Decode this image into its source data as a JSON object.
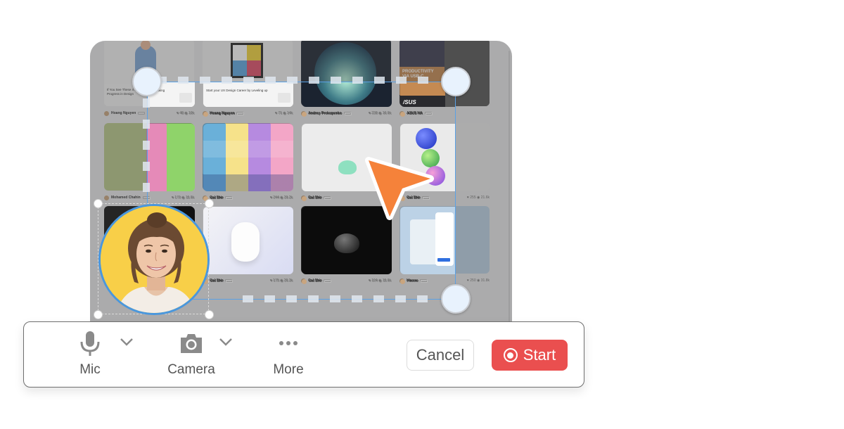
{
  "gallery": {
    "cards": [
      {
        "author": "Hoang Nguyen",
        "caption": "If You See These 4 Signs, You're Making Progress in Design",
        "likes": "48",
        "views": "10k",
        "thumb": "illustration-person"
      },
      {
        "author": "Hoang Nguyen",
        "caption": "Start your UX Design Career by Leveling up",
        "likes": "71",
        "views": "14k",
        "thumb": "illustration-ux"
      },
      {
        "author": "Andrey Prokopenko",
        "caption": "",
        "likes": "238",
        "views": "16.6k",
        "thumb": "forest-circle"
      },
      {
        "author": "ASUS NA",
        "caption": "",
        "likes": "",
        "views": "",
        "thumb": "asus-ad",
        "ad_text": "PRODUCTIVITY VIA USB-C.",
        "brand": "/SUS"
      },
      {
        "author": "Mohamed Chahin",
        "caption": "",
        "likes": "179",
        "views": "15.6k",
        "thumb": "cartoon"
      },
      {
        "author": "Gal Shir",
        "caption": "",
        "likes": "244",
        "views": "29.2k",
        "thumb": "blobs-grid"
      },
      {
        "author": "Gal Shir",
        "caption": "",
        "likes": "",
        "views": "",
        "thumb": "mint-blob"
      },
      {
        "author": "Gal Shir",
        "caption": "",
        "likes": "255",
        "views": "21.6k",
        "thumb": "glass-balls"
      },
      {
        "author": "",
        "caption": "",
        "likes": "",
        "views": "",
        "thumb": "dark"
      },
      {
        "author": "Gal Shir",
        "caption": "",
        "likes": "175",
        "views": "26.3k",
        "thumb": "white-3d"
      },
      {
        "author": "Gal Shir",
        "caption": "",
        "likes": "104",
        "views": "15.6k",
        "thumb": "black-blob"
      },
      {
        "author": "Hiwow",
        "caption": "",
        "likes": "250",
        "views": "31.8k",
        "thumb": "map-app"
      }
    ]
  },
  "toolbar": {
    "mic_label": "Mic",
    "camera_label": "Camera",
    "more_label": "More",
    "cancel_label": "Cancel",
    "start_label": "Start"
  },
  "colors": {
    "start": "#ea4f4f",
    "selection": "#5aa1e6",
    "cursor": "#f5823a",
    "camera_bg": "#f8cf48"
  }
}
